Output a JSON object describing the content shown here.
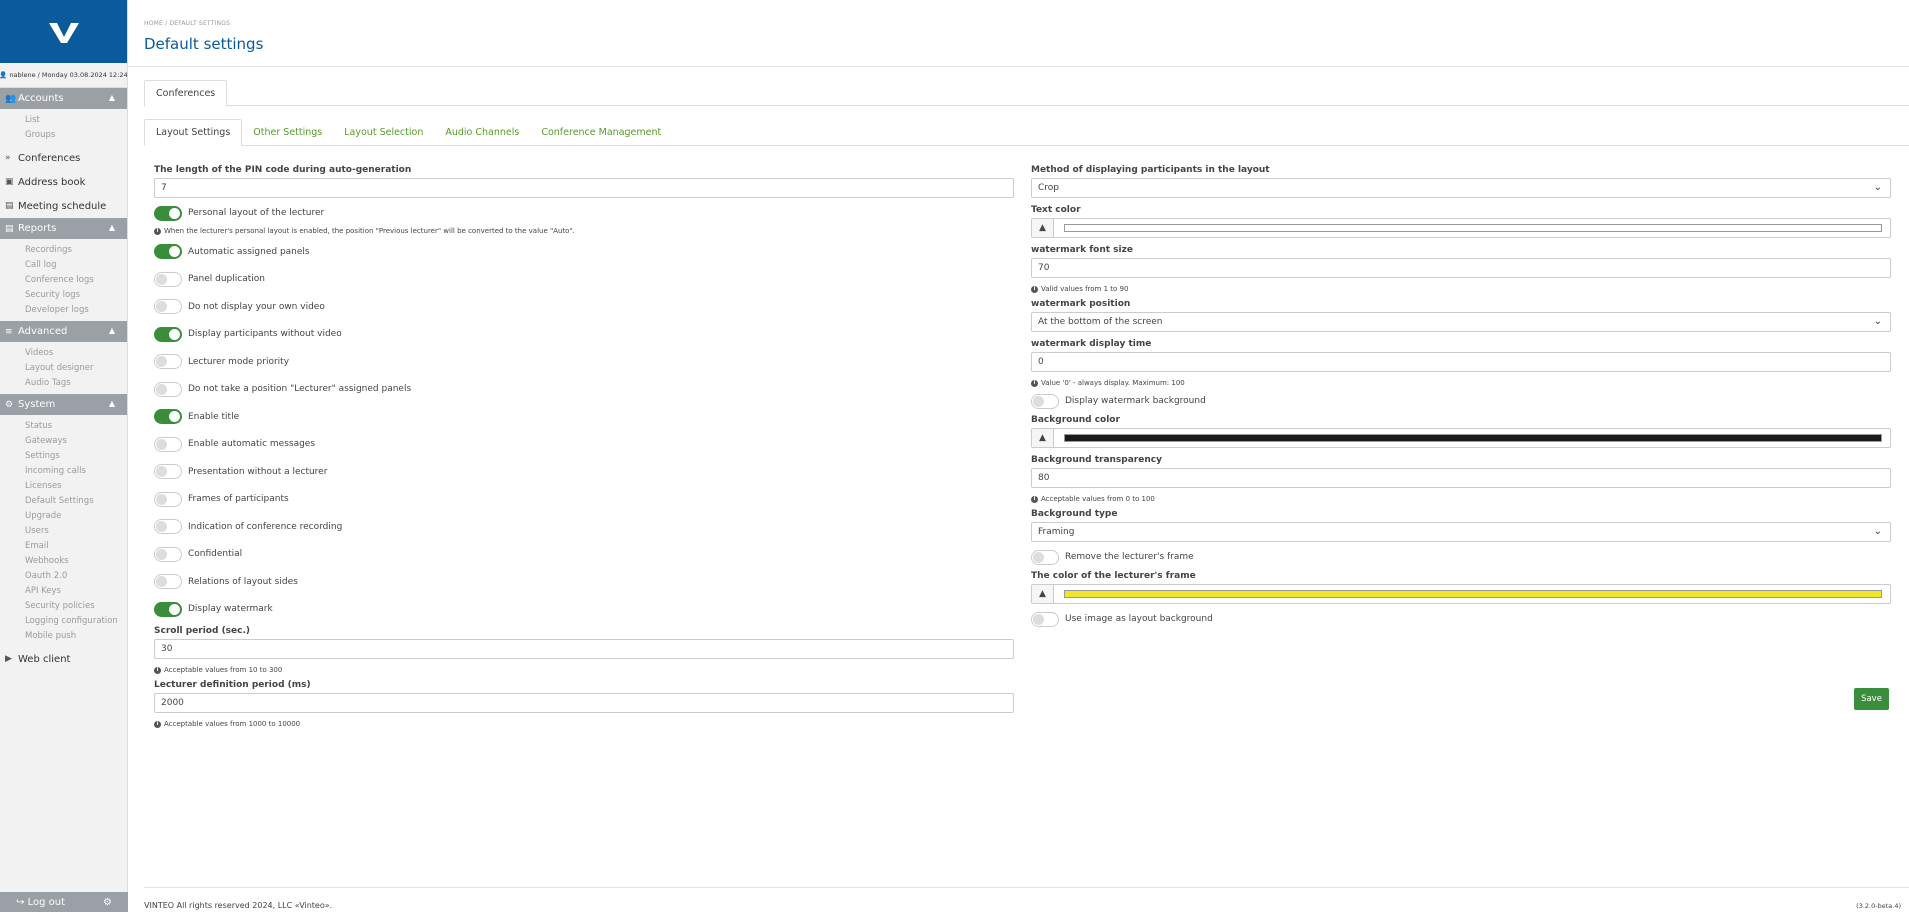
{
  "sidebar": {
    "user_line": "nablene / Monday 03.08.2024 12:24",
    "accounts": {
      "label": "Accounts",
      "items": [
        "List",
        "Groups"
      ]
    },
    "conferences": "Conferences",
    "address_book": "Address book",
    "meeting_schedule": "Meeting schedule",
    "reports": {
      "label": "Reports",
      "items": [
        "Recordings",
        "Call log",
        "Conference logs",
        "Security logs",
        "Developer logs"
      ]
    },
    "advanced": {
      "label": "Advanced",
      "items": [
        "Videos",
        "Layout designer",
        "Audio Tags"
      ]
    },
    "system": {
      "label": "System",
      "items": [
        "Status",
        "Gateways",
        "Settings",
        "Incoming calls",
        "Licenses",
        "Default Settings",
        "Upgrade",
        "Users",
        "Email",
        "Webhooks",
        "Oauth 2.0",
        "API Keys",
        "Security policies",
        "Logging configuration",
        "Mobile push"
      ]
    },
    "web_client": "Web client",
    "logout": "Log out"
  },
  "header": {
    "breadcrumb": "HOME  /  DEFAULT SETTINGS",
    "title": "Default settings"
  },
  "tabs_top": [
    "Conferences"
  ],
  "tabs": [
    "Layout Settings",
    "Other Settings",
    "Layout Selection",
    "Audio Channels",
    "Conference Management"
  ],
  "left": {
    "pin_label": "The length of the PIN code during auto-generation",
    "pin_value": "7",
    "personal_layout": "Personal layout of the lecturer",
    "personal_hint": "When the lecturer's personal layout is enabled, the position \"Previous lecturer\" will be converted to the value \"Auto\".",
    "toggles": [
      {
        "label": "Automatic assigned panels",
        "on": true
      },
      {
        "label": "Panel duplication",
        "on": false
      },
      {
        "label": "Do not display your own video",
        "on": false
      },
      {
        "label": "Display participants without video",
        "on": true
      },
      {
        "label": "Lecturer mode priority",
        "on": false
      },
      {
        "label": "Do not take a position \"Lecturer\" assigned panels",
        "on": false
      },
      {
        "label": "Enable title",
        "on": true
      },
      {
        "label": "Enable automatic messages",
        "on": false
      },
      {
        "label": "Presentation without a lecturer",
        "on": false
      },
      {
        "label": "Frames of participants",
        "on": false
      },
      {
        "label": "Indication of conference recording",
        "on": false
      },
      {
        "label": "Confidential",
        "on": false
      },
      {
        "label": "Relations of layout sides",
        "on": false
      },
      {
        "label": "Display watermark",
        "on": true
      }
    ],
    "scroll_label": "Scroll period (sec.)",
    "scroll_value": "30",
    "scroll_hint": "Acceptable values from 10 to 300",
    "lecturer_label": "Lecturer definition period (ms)",
    "lecturer_value": "2000",
    "lecturer_hint": "Acceptable values from 1000 to 10000"
  },
  "right": {
    "method_label": "Method of displaying participants in the layout",
    "method_value": "Crop",
    "text_color_label": "Text color",
    "text_color": "#ffffff",
    "wm_size_label": "watermark font size",
    "wm_size_value": "70",
    "wm_size_hint": "Valid values from 1 to 90",
    "wm_pos_label": "watermark position",
    "wm_pos_value": "At the bottom of the screen",
    "wm_time_label": "watermark display time",
    "wm_time_value": "0",
    "wm_time_hint": "Value '0' - always display. Maximum: 100",
    "wm_bg_toggle": "Display watermark background",
    "bg_color_label": "Background color",
    "bg_color": "#1a1a1a",
    "bg_transp_label": "Background transparency",
    "bg_transp_value": "80",
    "bg_transp_hint": "Acceptable values from 0 to 100",
    "bg_type_label": "Background type",
    "bg_type_value": "Framing",
    "remove_frame": "Remove the lecturer's frame",
    "frame_color_label": "The color of the lecturer's frame",
    "frame_color": "#f0e52a",
    "use_image": "Use image as layout background"
  },
  "save_label": "Save",
  "footer": {
    "text": "VINTEO   All rights reserved 2024, LLC «Vinteo».",
    "version": "(3.2.0-beta.4)"
  },
  "colors": {
    "brand": "#0b5a9c",
    "accent": "#3a8d3a",
    "link": "#5a9a2a"
  }
}
